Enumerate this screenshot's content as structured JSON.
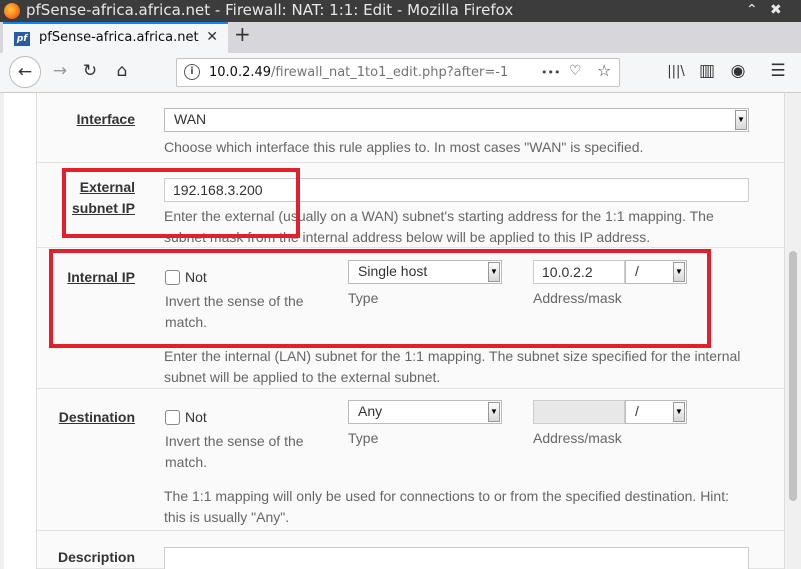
{
  "window": {
    "title": "pfSense-africa.africa.net - Firewall: NAT: 1:1: Edit - Mozilla Firefox",
    "minimize_icon": "⌃",
    "close_icon": "✖"
  },
  "tab": {
    "favicon_text": "pf",
    "label": "pfSense-africa.africa.net",
    "close": "✕",
    "new_tab": "+"
  },
  "nav": {
    "back": "←",
    "forward": "→",
    "reload": "↻",
    "home": "⌂",
    "url_host": "10.0.2.49",
    "url_path": "/firewall_nat_1to1_edit.php?after=-1",
    "more": "•••",
    "pocket": "♡",
    "star": "☆",
    "library": "|||\\",
    "sidebar": "▥",
    "account": "◉",
    "menu": "☰"
  },
  "form": {
    "interface": {
      "label": "Interface",
      "value": "WAN",
      "help": "Choose which interface this rule applies to. In most cases \"WAN\" is specified."
    },
    "external_subnet": {
      "label_line1": "External",
      "label_line2": "subnet IP",
      "value": "192.168.3.200",
      "help_line1": "Enter the external (usually on a WAN) subnet's starting address for the 1:1 mapping. The",
      "help_line2": "subnet mask from the internal address below will be applied to this IP address."
    },
    "internal_ip": {
      "label": "Internal IP",
      "not_label": "Not",
      "not_help_line1": "Invert the sense of the",
      "not_help_line2": "match.",
      "type_value": "Single host",
      "type_label": "Type",
      "address_value": "10.0.2.2",
      "mask_value": "/",
      "address_label": "Address/mask",
      "help_line1": "Enter the internal (LAN) subnet for the 1:1 mapping. The subnet size specified for the internal",
      "help_line2": "subnet will be applied to the external subnet."
    },
    "destination": {
      "label": "Destination",
      "not_label": "Not",
      "not_help_line1": "Invert the sense of the",
      "not_help_line2": "match.",
      "type_value": "Any",
      "type_label": "Type",
      "address_value": "",
      "mask_value": "/",
      "address_label": "Address/mask",
      "help_line1": "The 1:1 mapping will only be used for connections to or from the specified destination. Hint:",
      "help_line2": "this is usually \"Any\"."
    },
    "description": {
      "label": "Description",
      "value": ""
    }
  },
  "colors": {
    "highlight": "#e0202a",
    "tab_accent": "#0a84ff"
  }
}
